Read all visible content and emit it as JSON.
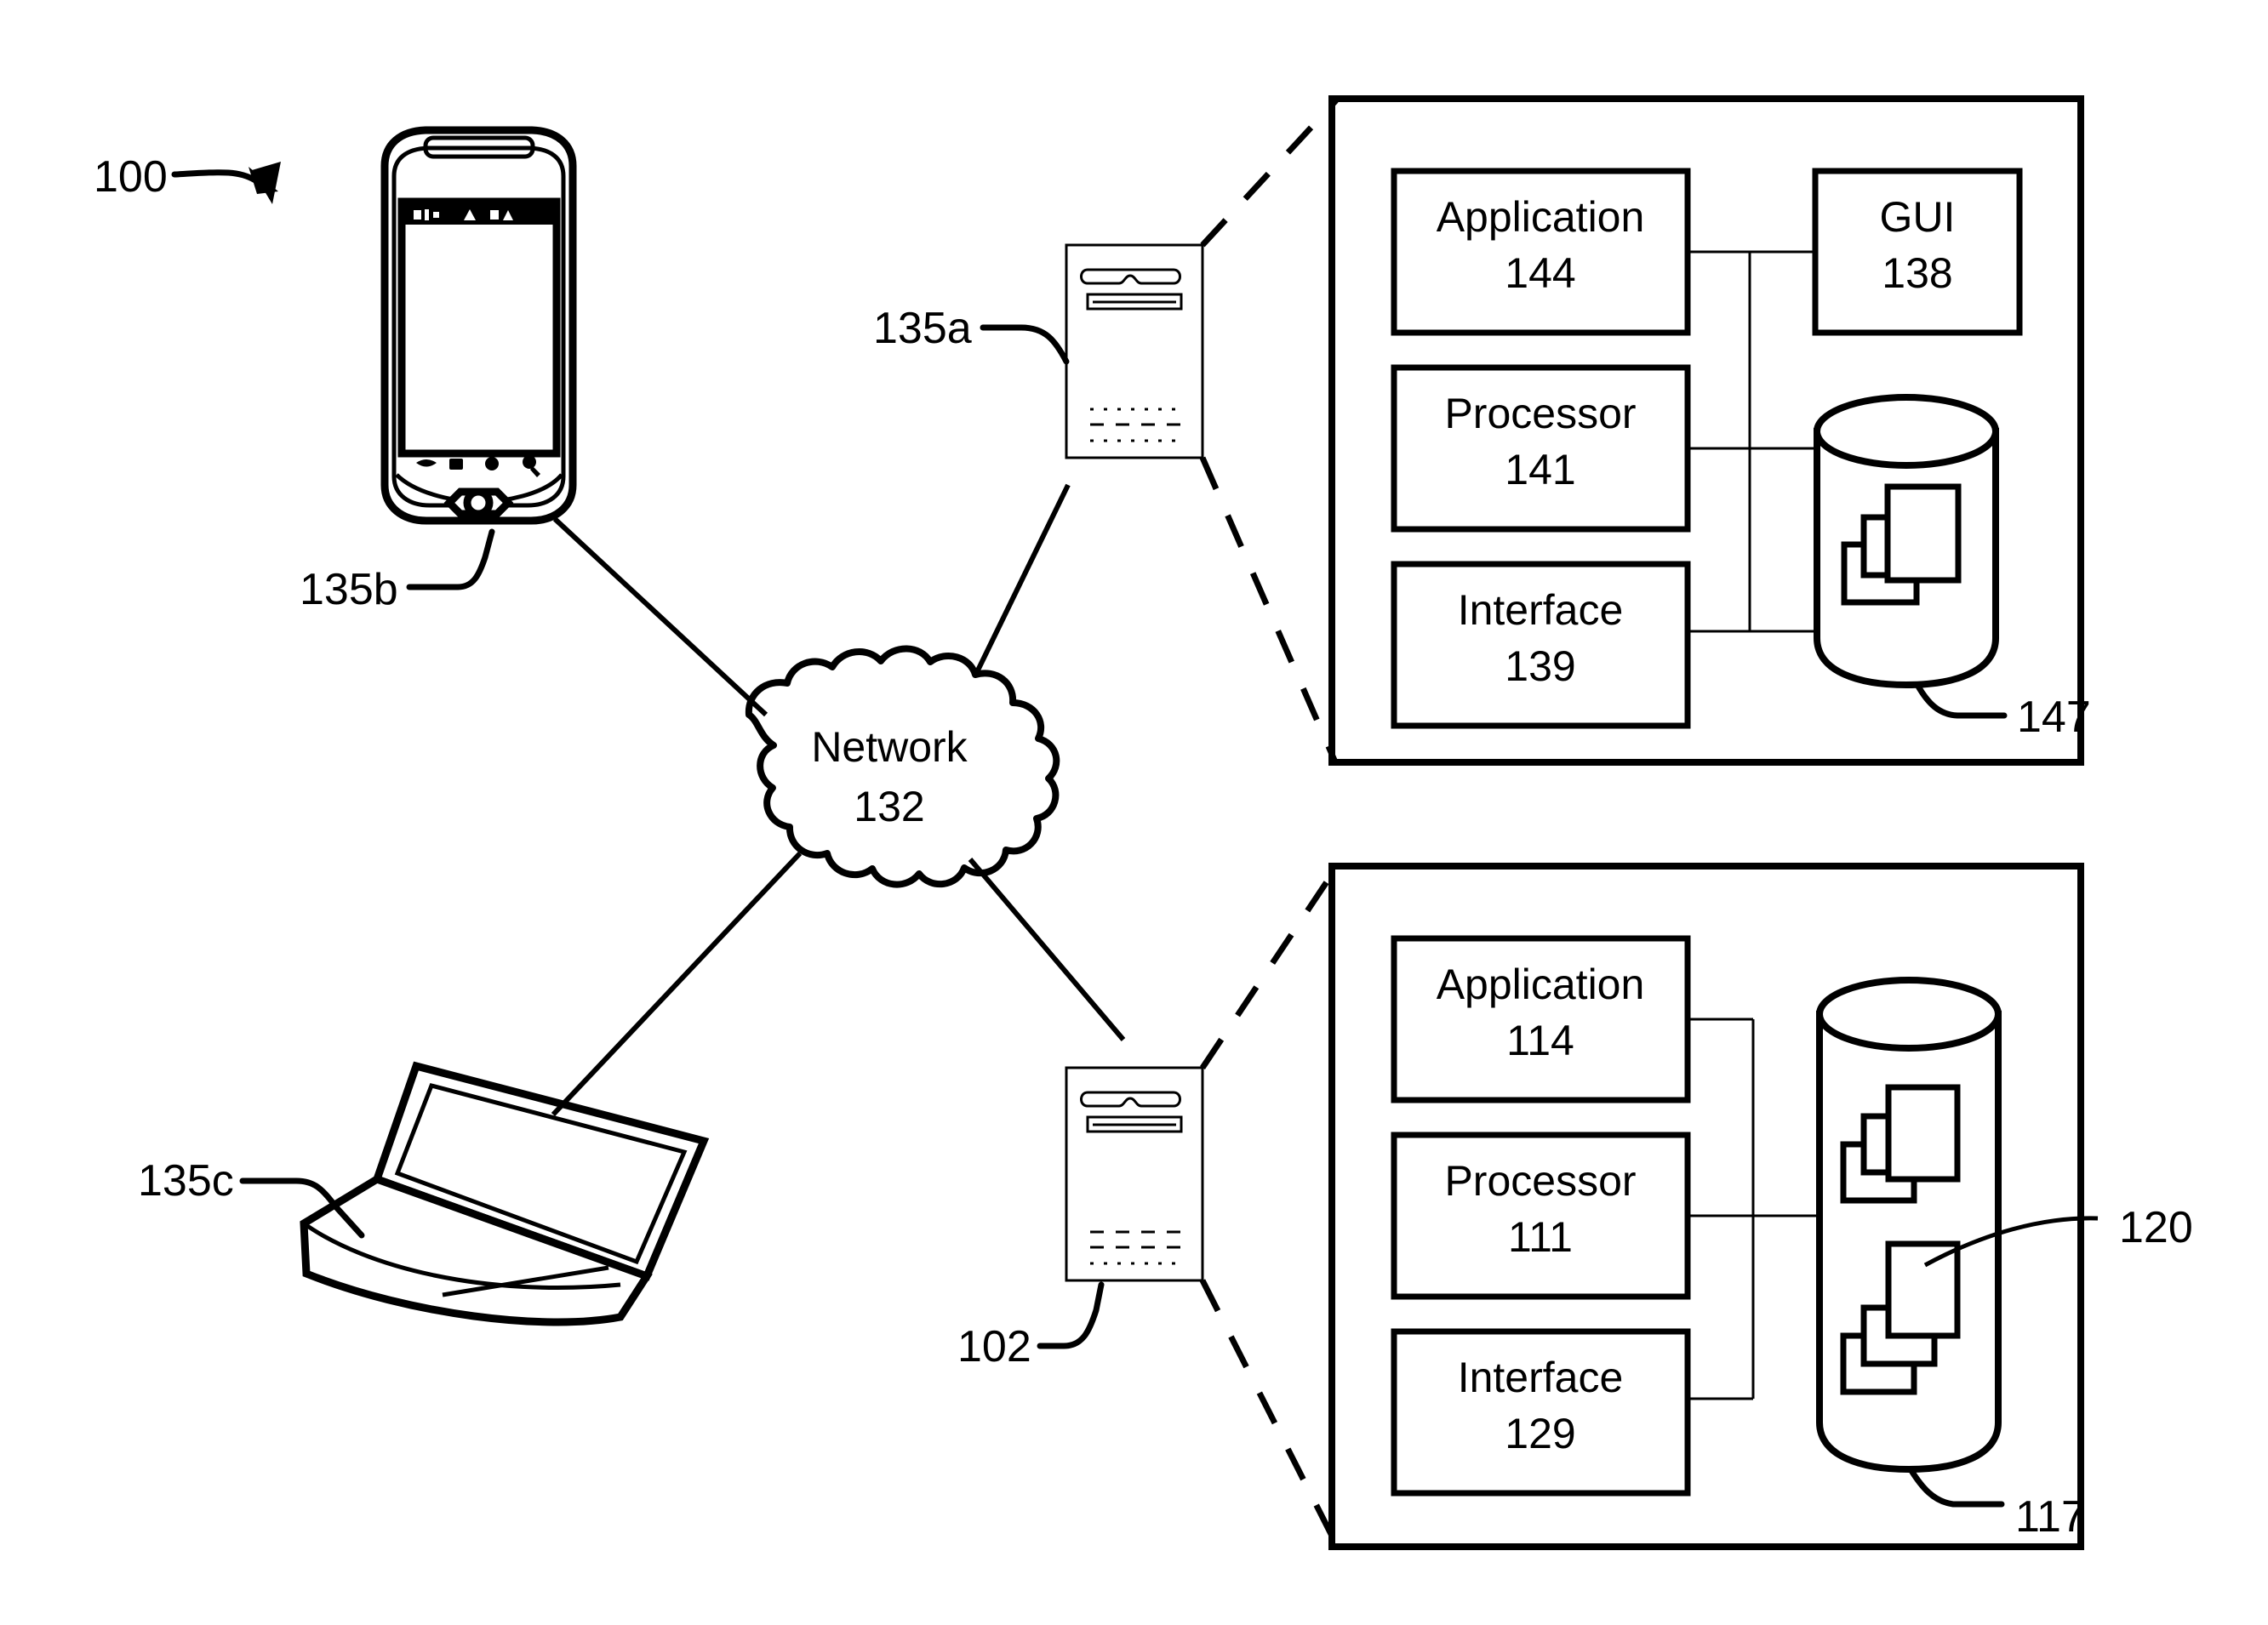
{
  "figure": {
    "figure_ref": "100",
    "background_color": "#ffffff",
    "line_color": "#000000"
  },
  "network": {
    "label": "Network",
    "ref": "132",
    "icon": "cloud-icon"
  },
  "clients": [
    {
      "id": "smartphone",
      "ref": "135b",
      "icon": "smartphone-icon"
    },
    {
      "id": "laptop",
      "ref": "135c",
      "icon": "laptop-icon"
    }
  ],
  "servers": [
    {
      "id": "server-top",
      "ref": "135a",
      "icon": "server-tower-icon"
    },
    {
      "id": "server-bottom",
      "ref": "102",
      "icon": "server-tower-icon"
    }
  ],
  "panels": [
    {
      "id": "panel-top",
      "source_ref": "135a",
      "boxes": [
        {
          "id": "application-144",
          "label": "Application",
          "ref": "144"
        },
        {
          "id": "gui-138",
          "label": "GUI",
          "ref": "138"
        },
        {
          "id": "processor-141",
          "label": "Processor",
          "ref": "141"
        },
        {
          "id": "interface-139",
          "label": "Interface",
          "ref": "139"
        }
      ],
      "datastore": {
        "id": "datastore-147",
        "ref": "147",
        "icon": "database-cylinder-icon",
        "contents_icon": "stacked-documents-icon"
      }
    },
    {
      "id": "panel-bottom",
      "source_ref": "102",
      "boxes": [
        {
          "id": "application-114",
          "label": "Application",
          "ref": "114"
        },
        {
          "id": "processor-111",
          "label": "Processor",
          "ref": "111"
        },
        {
          "id": "interface-129",
          "label": "Interface",
          "ref": "129"
        }
      ],
      "datastore": {
        "id": "datastore-117",
        "ref": "117",
        "icon": "database-cylinder-icon",
        "contents_icon": "stacked-documents-icon",
        "item_ref": "120"
      }
    }
  ]
}
